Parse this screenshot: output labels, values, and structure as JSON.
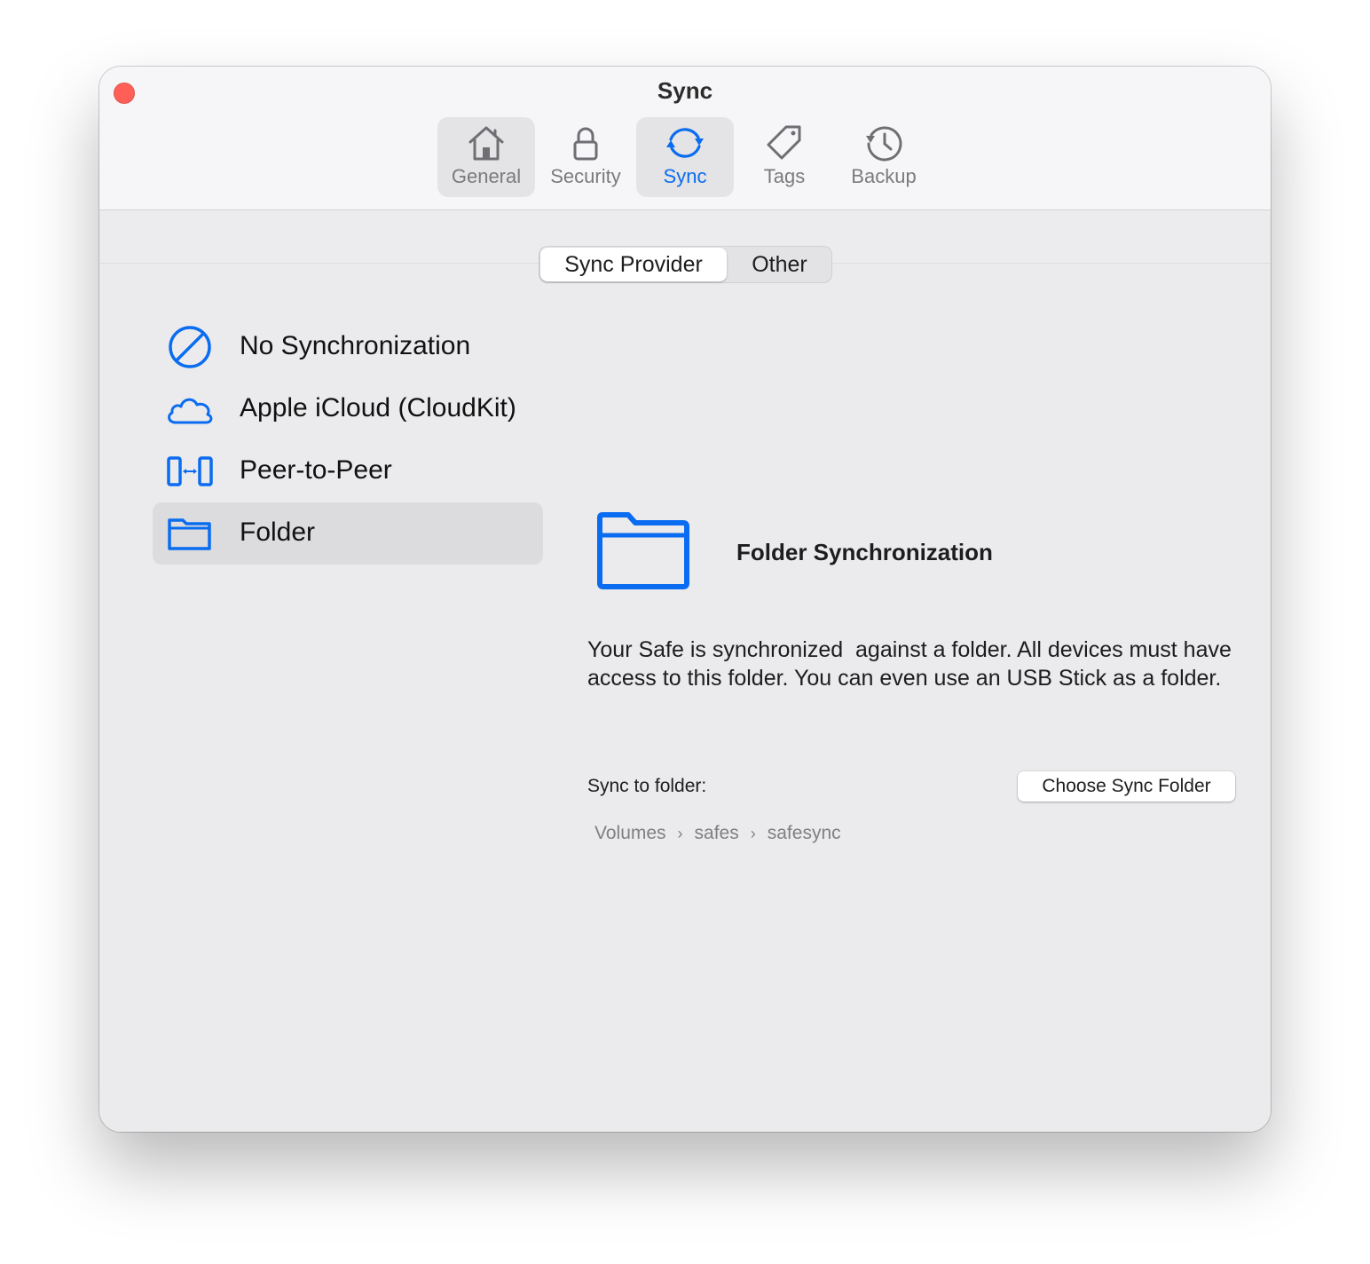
{
  "window": {
    "title": "Sync"
  },
  "toolbar": {
    "items": [
      {
        "label": "General",
        "icon": "house-icon"
      },
      {
        "label": "Security",
        "icon": "lock-icon"
      },
      {
        "label": "Sync",
        "icon": "sync-arrows-icon",
        "active": true
      },
      {
        "label": "Tags",
        "icon": "tag-icon"
      },
      {
        "label": "Backup",
        "icon": "clock-history-icon"
      }
    ]
  },
  "segmented": {
    "options": [
      "Sync Provider",
      "Other"
    ],
    "selected": "Sync Provider"
  },
  "providers": {
    "items": [
      {
        "label": "No Synchronization",
        "icon": "prohibited-icon"
      },
      {
        "label": "Apple iCloud (CloudKit)",
        "icon": "cloud-icon"
      },
      {
        "label": "Peer-to-Peer",
        "icon": "peer-devices-icon"
      },
      {
        "label": "Folder",
        "icon": "folder-icon",
        "selected": true
      }
    ]
  },
  "detail": {
    "title": "Folder Synchronization",
    "icon": "folder-icon",
    "description": "Your Safe is synchronized  against a folder. All devices must have access to this folder. You can even use an USB Stick as a folder.",
    "sync_to_label": "Sync to folder:",
    "choose_button": "Choose Sync Folder",
    "path": [
      "Volumes",
      "safes",
      "safesync"
    ]
  },
  "colors": {
    "accent": "#0a6cf0",
    "close": "#ff5f57"
  }
}
